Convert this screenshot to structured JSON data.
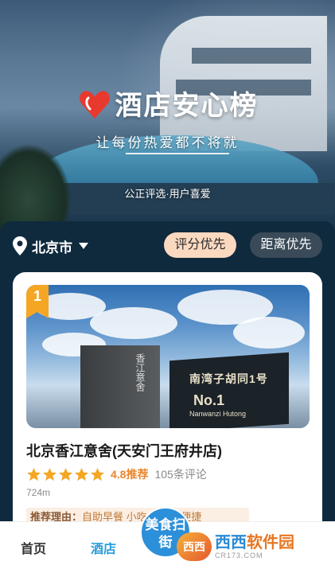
{
  "hero": {
    "title": "酒店安心榜",
    "slogan": "让每份热爱都不将就",
    "subtitle": "公正评选·用户喜爱"
  },
  "filter": {
    "city": "北京市",
    "sort_rating": "评分优先",
    "sort_distance": "距离优先",
    "active": "sort_rating"
  },
  "hotel": {
    "rank": "1",
    "name": "北京香江意舍(天安门王府井店)",
    "rating_stars": 5,
    "score": "4.8推荐",
    "reviews": "105条评论",
    "distance": "724m",
    "reason_label": "推荐理由：",
    "reason_text": "自助早餐 小吃 水购物便捷",
    "photo_sign_line1": "南湾子胡同1号",
    "photo_sign_line2": "No.1",
    "photo_sign_line3": "Nanwanzi Hutong",
    "photo_sign_left": "香江意舍"
  },
  "tabbar": {
    "home": "首页",
    "hotel": "酒店",
    "food": "美食扫街"
  },
  "watermark": {
    "logo": "西西",
    "name_part1": "西西",
    "name_part2": "软件园",
    "url": "CR173.COM"
  },
  "colors": {
    "accent": "#2c9ddb",
    "star": "#f5a623",
    "score": "#e8862d",
    "sort_active_bg": "#fbd9c0",
    "dark_bg": "#0f2a3d"
  }
}
